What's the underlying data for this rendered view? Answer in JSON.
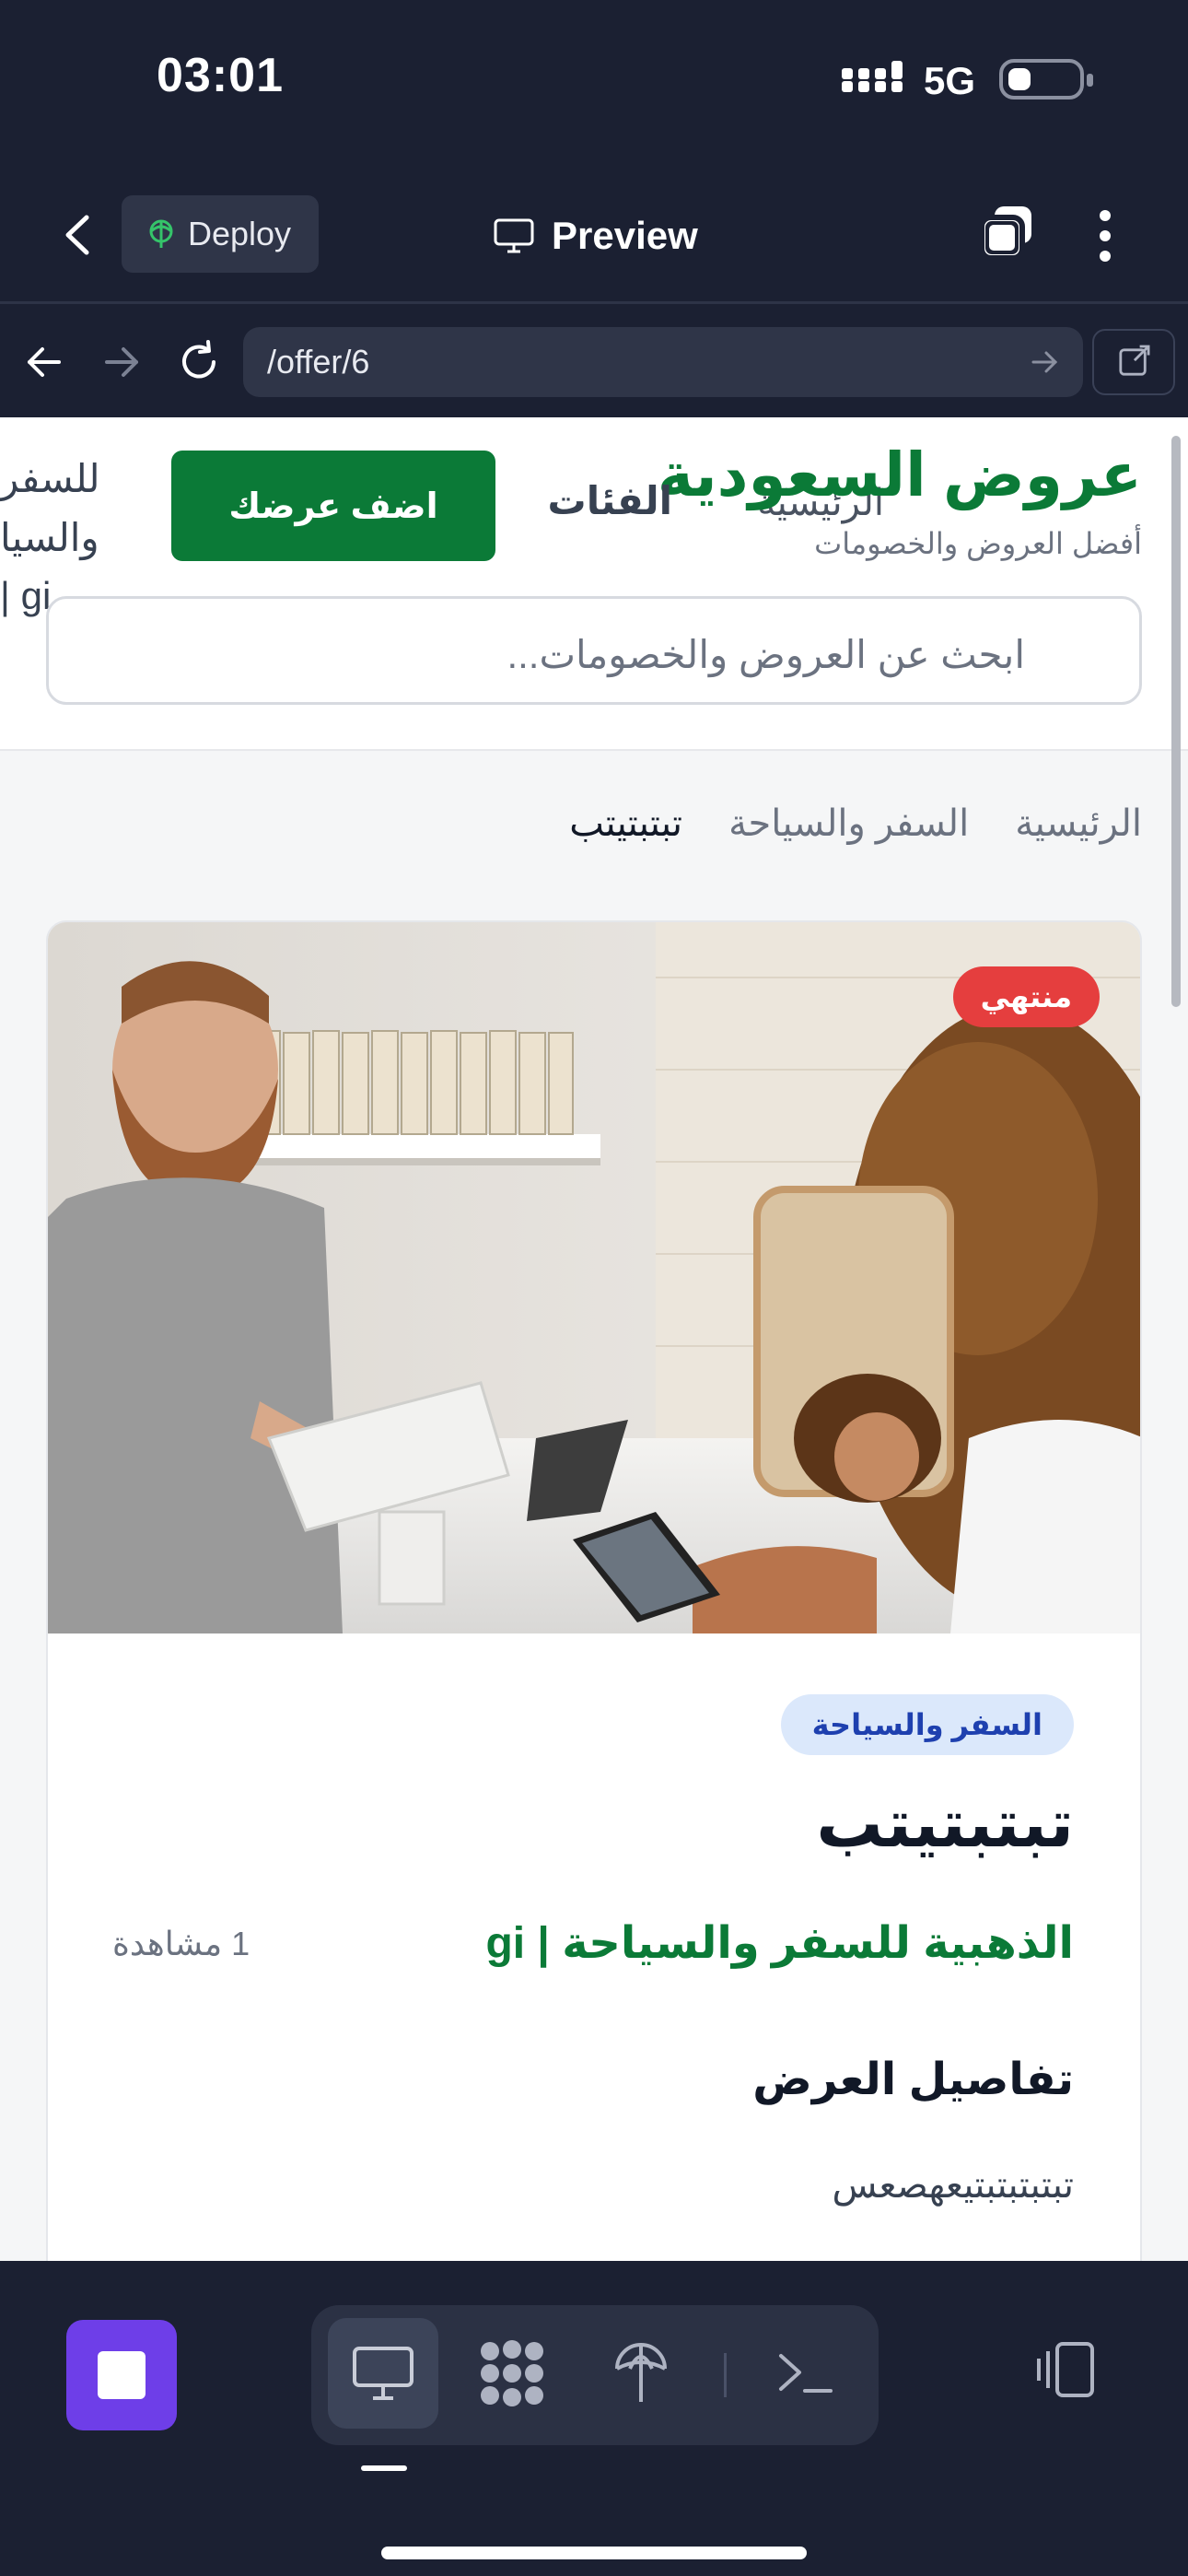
{
  "status_bar": {
    "time": "03:01",
    "network": "5G"
  },
  "app_bar": {
    "deploy_label": "Deploy",
    "preview_label": "Preview"
  },
  "browser": {
    "url": "/offer/6"
  },
  "site": {
    "title": "عروض السعودية",
    "tagline": "أفضل العروض والخصومات",
    "nav_home": "الرئيسية",
    "nav_categories": "الفئات",
    "add_offer": "اضف عرضك",
    "search_placeholder": "ابحث عن العروض والخصومات...",
    "overflow_lines": [
      "للسفر",
      "والسيا",
      "gi |"
    ]
  },
  "breadcrumb": {
    "home": "الرئيسية",
    "category": "السفر والسياحة",
    "current": "تبتبتيتب"
  },
  "offer": {
    "status_badge": "منتهي",
    "category_tag": "السفر والسياحة",
    "title": "تبتبتيتب",
    "store": "الذهبية للسفر والسياحة | gi",
    "views": "1 مشاهدة",
    "details_heading": "تفاصيل العرض",
    "details_text": "تبتبتبتبتيعهصعس"
  },
  "colors": {
    "brand": "#0b7a37",
    "badge_red": "#e53e3e",
    "stop_purple": "#6e3ee8",
    "chrome_bg": "#1b2032"
  }
}
